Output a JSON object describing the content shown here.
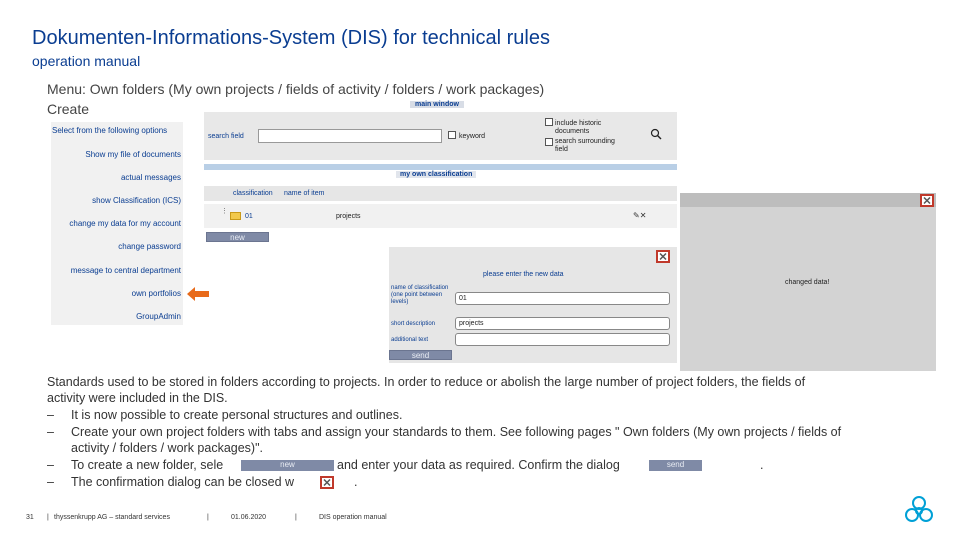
{
  "header": {
    "title": "Dokumenten-Informations-System (DIS) for technical rules",
    "subtitle": "operation manual",
    "menu_line": "Menu: Own folders (My own projects / fields of activity / folders / work packages)",
    "create_label": "Create"
  },
  "menu": {
    "header": "Select from the following options",
    "items": [
      "Show my file of documents",
      "actual messages",
      "show Classification (ICS)",
      "change my data for my account",
      "change password",
      "message to central department",
      "own portfolios",
      "GroupAdmin"
    ]
  },
  "main_window": {
    "title": "main window",
    "search_label": "search field",
    "search_value": "",
    "keyword_label": "keyword",
    "include_historic_label": "include historic documents",
    "search_surrounding_label": "search surrounding field",
    "classification_title": "my own classification",
    "columns": [
      "classification",
      "name of item"
    ],
    "rows": [
      {
        "classification": "01",
        "name": "projects"
      }
    ],
    "new_button": "new"
  },
  "new_data_dialog": {
    "title": "please enter the new data",
    "fields": [
      {
        "label": "name of classification (one point between levels)",
        "value": "01"
      },
      {
        "label": "short description",
        "value": "projects"
      },
      {
        "label": "additional text",
        "value": ""
      }
    ],
    "send_button": "send"
  },
  "confirmation": {
    "text": "changed data!"
  },
  "body": {
    "para1_line1": "Standards used to be stored in folders according to projects. In order to reduce or abolish the large number of project folders, the fields of",
    "para1_line2": "activity were included in the DIS.",
    "bullet1": "It is now possible to create personal structures and outlines.",
    "bullet2_line1": "Create your own project folders with tabs and assign your standards to them. See following pages \" Own folders (My own projects / fields of",
    "bullet2_line2": "activity / folders / work packages)\".",
    "bullet3_part1": "To create a new folder, sele",
    "bullet3_part2": "and enter your data as required. Confirm the dialog",
    "bullet3_end": ".",
    "bullet4_part1": "The confirmation dialog can be closed w",
    "bullet4_end": ".",
    "inline_new": "new",
    "inline_send": "send",
    "dash": "–"
  },
  "footer": {
    "page": "31",
    "company": "thyssenkrupp AG – standard services",
    "sep": "|",
    "date": "01.06.2020",
    "doc": "DIS operation manual"
  },
  "colors": {
    "title_blue": "#0a3d91",
    "button_gray": "#7f8aa6",
    "close_red": "#c0392b",
    "arrow_orange": "#e86a1a",
    "logo_blue": "#00a0d6"
  }
}
